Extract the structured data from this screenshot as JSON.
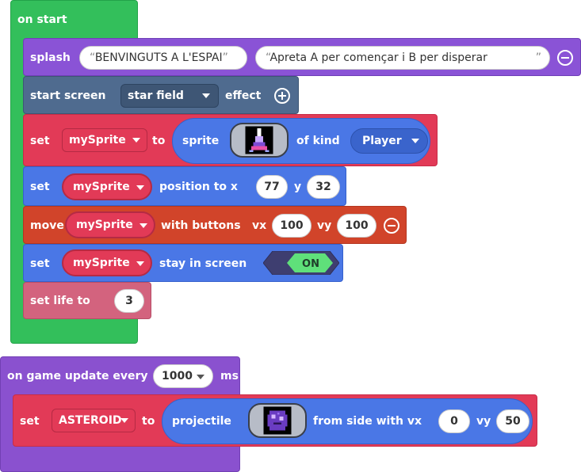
{
  "on_start": {
    "label": "on start",
    "splash": {
      "label": "splash",
      "arg1": "BENVINGUTS A L'ESPAI",
      "arg2": "Apreta A per començar i B per disperar"
    },
    "start_screen": {
      "label": "start screen",
      "effect_value": "star field",
      "effect_label": "effect"
    },
    "set_sprite": {
      "set_label": "set",
      "variable": "mySprite",
      "to_label": "to",
      "sprite_label": "sprite",
      "kind_label": "of kind",
      "kind_value": "Player"
    },
    "set_position": {
      "set_label": "set",
      "variable": "mySprite",
      "position_label": "position to x",
      "x": "77",
      "y_label": "y",
      "y": "32"
    },
    "move": {
      "move_label": "move",
      "variable": "mySprite",
      "with_buttons_label": "with buttons",
      "vx_label": "vx",
      "vx": "100",
      "vy_label": "vy",
      "vy": "100"
    },
    "stay_in_screen": {
      "set_label": "set",
      "variable": "mySprite",
      "stay_label": "stay in screen",
      "toggle": "ON"
    },
    "set_life": {
      "label": "set life to",
      "value": "3"
    }
  },
  "on_game_update": {
    "label": "on game update every",
    "interval": "1000",
    "unit": "ms",
    "set_projectile": {
      "set_label": "set",
      "variable": "ASTEROID",
      "to_label": "to",
      "projectile_label": "projectile",
      "from_side_label": "from side with vx",
      "vx": "0",
      "vy_label": "vy",
      "vy": "50"
    }
  },
  "colors": {
    "event_green": "#33bf5b",
    "game_purple": "#8a53d6",
    "scene_slate": "#4f6b8f",
    "variables_red": "#e23a57",
    "sprites_blue": "#4a77e6",
    "controller_orange": "#d1442a",
    "info_pink": "#d3637e",
    "toggle_green": "#5fe07a"
  }
}
